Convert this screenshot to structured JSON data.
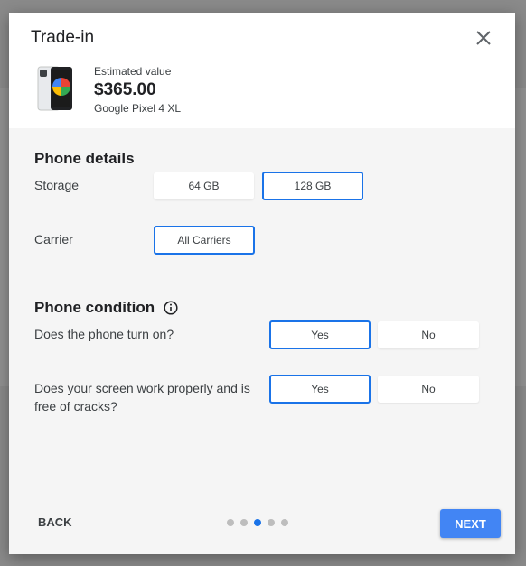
{
  "modal": {
    "title": "Trade-in",
    "estimate_label": "Estimated value",
    "estimate_value": "$365.00",
    "device_name": "Google Pixel 4 XL"
  },
  "phone_details": {
    "title": "Phone details",
    "storage": {
      "label": "Storage",
      "options": [
        "64 GB",
        "128 GB"
      ],
      "selected": "128 GB"
    },
    "carrier": {
      "label": "Carrier",
      "options": [
        "All Carriers"
      ],
      "selected": "All Carriers"
    }
  },
  "phone_condition": {
    "title": "Phone condition",
    "questions": [
      {
        "text": "Does the phone turn on?",
        "options": [
          "Yes",
          "No"
        ],
        "selected": "Yes"
      },
      {
        "text": "Does your screen work properly and is free of cracks?",
        "options": [
          "Yes",
          "No"
        ],
        "selected": "Yes"
      }
    ]
  },
  "footer": {
    "back_label": "BACK",
    "next_label": "NEXT",
    "steps_total": 5,
    "current_step": 3
  },
  "colors": {
    "accent": "#1a73e8",
    "next_button": "#4285f4"
  }
}
